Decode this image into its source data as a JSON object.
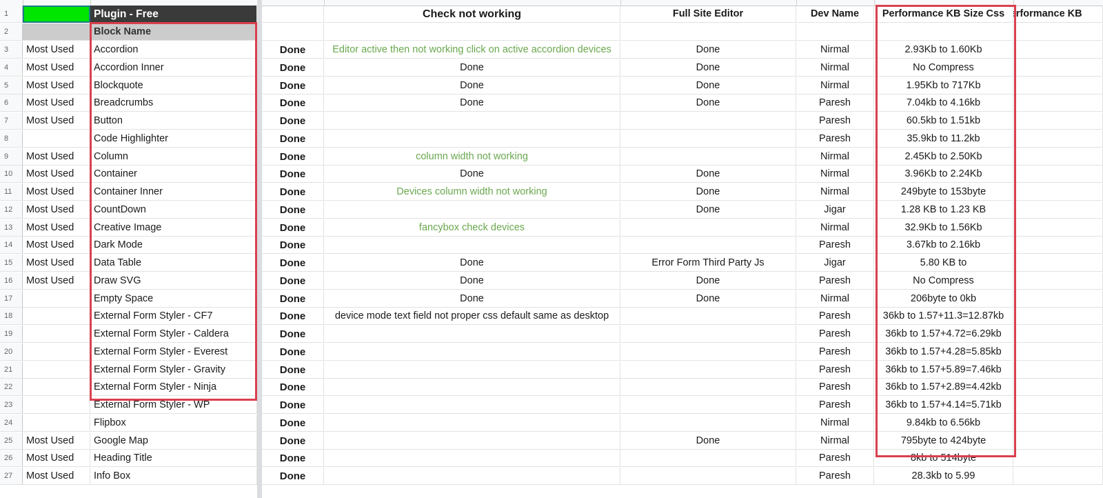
{
  "sheet": {
    "header_row": {
      "row_number": "1",
      "col_a": "",
      "col_b": "Plugin - Free",
      "col_c": "",
      "col_d": "Check not working",
      "col_e": "Full Site Editor",
      "col_f": "Dev Name",
      "col_g": "Performance KB Size Css",
      "col_h": "Performance KB"
    },
    "subheader_row": {
      "row_number": "2",
      "col_b": "Block Name"
    },
    "colors": {
      "a1_fill": "#00e600",
      "header_fill": "#3a3a3a",
      "subheader_fill": "#cccccc",
      "note_green": "#6aa84f",
      "highlight_red": "#d9404f"
    },
    "rows": [
      {
        "num": "3",
        "category": "Most Used",
        "block": "Accordion",
        "status": "Done",
        "check": "Editor active then not working click on active accordion devices",
        "check_green": true,
        "fse": "Done",
        "dev": "Nirmal",
        "perf": "2.93Kb to 1.60Kb"
      },
      {
        "num": "4",
        "category": "Most Used",
        "block": "Accordion Inner",
        "status": "Done",
        "check": "Done",
        "check_green": false,
        "fse": "Done",
        "dev": "Nirmal",
        "perf": "No Compress"
      },
      {
        "num": "5",
        "category": "Most Used",
        "block": "Blockquote",
        "status": "Done",
        "check": "Done",
        "check_green": false,
        "fse": "Done",
        "dev": "Nirmal",
        "perf": "1.95Kb to 717Kb"
      },
      {
        "num": "6",
        "category": "Most Used",
        "block": "Breadcrumbs",
        "status": "Done",
        "check": "Done",
        "check_green": false,
        "fse": "Done",
        "dev": "Paresh",
        "perf": "7.04kb to 4.16kb"
      },
      {
        "num": "7",
        "category": "Most Used",
        "block": "Button",
        "status": "Done",
        "check": "",
        "check_green": false,
        "fse": "",
        "dev": "Paresh",
        "perf": "60.5kb to 1.51kb"
      },
      {
        "num": "8",
        "category": "",
        "block": "Code Highlighter",
        "status": "Done",
        "check": "",
        "check_green": false,
        "fse": "",
        "dev": "Paresh",
        "perf": "35.9kb to 11.2kb"
      },
      {
        "num": "9",
        "category": "Most Used",
        "block": "Column",
        "status": "Done",
        "check": "column width not working",
        "check_green": true,
        "fse": "",
        "dev": "Nirmal",
        "perf": "2.45Kb to 2.50Kb"
      },
      {
        "num": "10",
        "category": "Most Used",
        "block": "Container",
        "status": "Done",
        "check": "Done",
        "check_green": false,
        "fse": "Done",
        "dev": "Nirmal",
        "perf": "3.96Kb to 2.24Kb"
      },
      {
        "num": "11",
        "category": "Most Used",
        "block": "Container Inner",
        "status": "Done",
        "check": "Devices column width not working",
        "check_green": true,
        "fse": "Done",
        "dev": "Nirmal",
        "perf": "249byte to 153byte"
      },
      {
        "num": "12",
        "category": "Most Used",
        "block": "CountDown",
        "status": "Done",
        "check": "",
        "check_green": false,
        "fse": "Done",
        "dev": "Jigar",
        "perf": "1.28 KB to  1.23 KB"
      },
      {
        "num": "13",
        "category": "Most Used",
        "block": "Creative Image",
        "status": "Done",
        "check": "fancybox check devices",
        "check_green": true,
        "fse": "",
        "dev": "Nirmal",
        "perf": "32.9Kb to 1.56Kb"
      },
      {
        "num": "14",
        "category": "Most Used",
        "block": "Dark Mode",
        "status": "Done",
        "check": "",
        "check_green": false,
        "fse": "",
        "dev": "Paresh",
        "perf": "3.67kb to 2.16kb"
      },
      {
        "num": "15",
        "category": "Most Used",
        "block": "Data Table",
        "status": "Done",
        "check": "Done",
        "check_green": false,
        "fse": "Error Form Third Party Js",
        "dev": "Jigar",
        "perf": "5.80 KB to"
      },
      {
        "num": "16",
        "category": "Most Used",
        "block": "Draw SVG",
        "status": "Done",
        "check": "Done",
        "check_green": false,
        "fse": "Done",
        "dev": "Paresh",
        "perf": "No Compress"
      },
      {
        "num": "17",
        "category": "",
        "block": "Empty Space",
        "status": "Done",
        "check": "Done",
        "check_green": false,
        "fse": "Done",
        "dev": "Nirmal",
        "perf": "206byte to 0kb"
      },
      {
        "num": "18",
        "category": "",
        "block": "External Form Styler - CF7",
        "status": "Done",
        "check": "device mode text field not proper css default same as desktop",
        "check_green": false,
        "fse": "",
        "dev": "Paresh",
        "perf": "36kb to 1.57+11.3=12.87kb"
      },
      {
        "num": "19",
        "category": "",
        "block": "External Form Styler - Caldera",
        "status": "Done",
        "check": "",
        "check_green": false,
        "fse": "",
        "dev": "Paresh",
        "perf": "36kb to 1.57+4.72=6.29kb"
      },
      {
        "num": "20",
        "category": "",
        "block": "External Form Styler - Everest",
        "status": "Done",
        "check": "",
        "check_green": false,
        "fse": "",
        "dev": "Paresh",
        "perf": "36kb to 1.57+4.28=5.85kb"
      },
      {
        "num": "21",
        "category": "",
        "block": "External Form Styler - Gravity",
        "status": "Done",
        "check": "",
        "check_green": false,
        "fse": "",
        "dev": "Paresh",
        "perf": "36kb to 1.57+5.89=7.46kb"
      },
      {
        "num": "22",
        "category": "",
        "block": "External Form Styler - Ninja",
        "status": "Done",
        "check": "",
        "check_green": false,
        "fse": "",
        "dev": "Paresh",
        "perf": "36kb to 1.57+2.89=4.42kb"
      },
      {
        "num": "23",
        "category": "",
        "block": "External Form Styler - WP",
        "status": "Done",
        "check": "",
        "check_green": false,
        "fse": "",
        "dev": "Paresh",
        "perf": "36kb to 1.57+4.14=5.71kb"
      },
      {
        "num": "24",
        "category": "",
        "block": "Flipbox",
        "status": "Done",
        "check": "",
        "check_green": false,
        "fse": "",
        "dev": "Nirmal",
        "perf": "9.84kb to 6.56kb"
      },
      {
        "num": "25",
        "category": "Most Used",
        "block": "Google Map",
        "status": "Done",
        "check": "",
        "check_green": false,
        "fse": "Done",
        "dev": "Nirmal",
        "perf": "795byte to 424byte"
      },
      {
        "num": "26",
        "category": "Most Used",
        "block": "Heading Title",
        "status": "Done",
        "check": "",
        "check_green": false,
        "fse": "",
        "dev": "Paresh",
        "perf": "8kb to 514byte"
      },
      {
        "num": "27",
        "category": "Most Used",
        "block": "Info Box",
        "status": "Done",
        "check": "",
        "check_green": false,
        "fse": "",
        "dev": "Paresh",
        "perf": "28.3kb to 5.99"
      }
    ]
  }
}
